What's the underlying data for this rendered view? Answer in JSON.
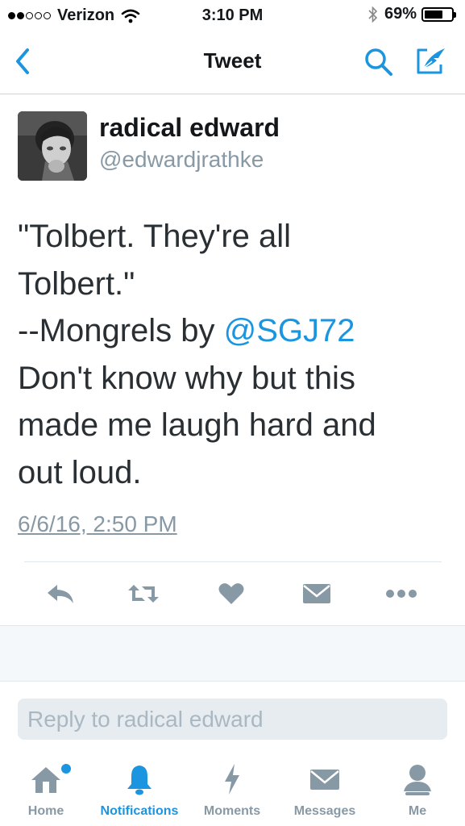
{
  "status_bar": {
    "signal_full": 2,
    "signal_total": 5,
    "carrier": "Verizon",
    "time": "3:10 PM",
    "battery_percent": "69%",
    "battery_level": 0.69,
    "icons": [
      "wifi-icon",
      "bluetooth-icon",
      "battery-icon"
    ]
  },
  "nav": {
    "title": "Tweet",
    "back_icon": "chevron-left-icon",
    "search_icon": "search-icon",
    "compose_icon": "compose-icon"
  },
  "tweet": {
    "display_name": "radical edward",
    "handle": "@edwardjrathke",
    "text_lines": [
      "\"Tolbert. They're all",
      "Tolbert.\"",
      "--Mongrels by ",
      "Don't know why but this",
      "made me laugh hard and",
      "out loud."
    ],
    "mention": "@SGJ72",
    "timestamp": "6/6/16, 2:50 PM"
  },
  "actions": [
    "reply-icon",
    "retweet-icon",
    "like-icon",
    "direct-message-icon",
    "more-icon"
  ],
  "reply": {
    "placeholder": "Reply to radical edward"
  },
  "tabs": [
    {
      "label": "Home",
      "icon": "home-icon",
      "has_badge": true
    },
    {
      "label": "Notifications",
      "icon": "bell-icon",
      "active": true
    },
    {
      "label": "Moments",
      "icon": "lightning-icon"
    },
    {
      "label": "Messages",
      "icon": "envelope-icon"
    },
    {
      "label": "Me",
      "icon": "person-icon"
    }
  ],
  "colors": {
    "accent": "#1b95e0",
    "icon_gray": "#8899a6",
    "text_dark": "#292f33",
    "muted": "#8899a6"
  }
}
